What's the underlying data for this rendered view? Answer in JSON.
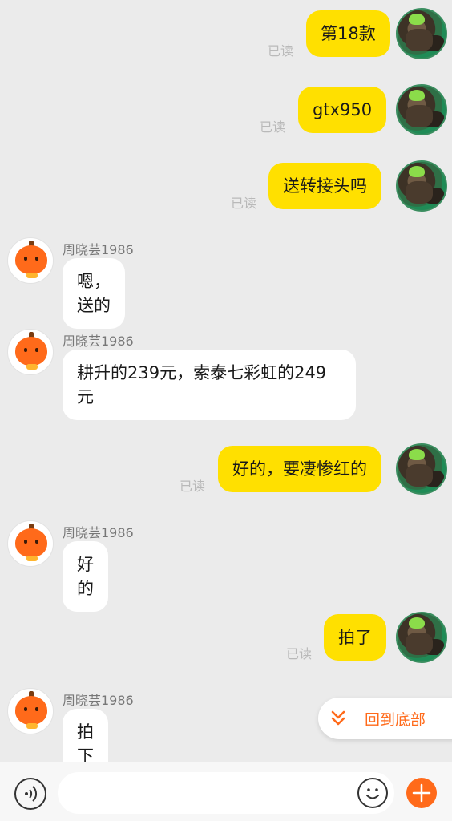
{
  "read_label": "已读",
  "contact_name": "周晓芸1986",
  "messages": [
    {
      "from": "me",
      "text": "第18款"
    },
    {
      "from": "me",
      "text": "gtx950"
    },
    {
      "from": "me",
      "text": "送转接头吗"
    },
    {
      "from": "other",
      "text": "嗯，送的"
    },
    {
      "from": "other",
      "text": "耕升的239元，索泰七彩虹的249元"
    },
    {
      "from": "me",
      "text": "好的，要凄惨红的"
    },
    {
      "from": "other",
      "text": "好的"
    },
    {
      "from": "me",
      "text": "拍了"
    },
    {
      "from": "other",
      "text": "拍下我改价"
    }
  ],
  "back_to_bottom": "回到底部",
  "input": {
    "placeholder": "",
    "value": ""
  },
  "icons": {
    "voice": "voice-icon",
    "emoji": "emoji-icon",
    "plus": "plus-icon",
    "chevron": "double-chevron-down-icon"
  },
  "colors": {
    "bubble_me": "#ffe000",
    "bubble_other": "#ffffff",
    "accent": "#ff6a1a",
    "background": "#ebebeb"
  }
}
